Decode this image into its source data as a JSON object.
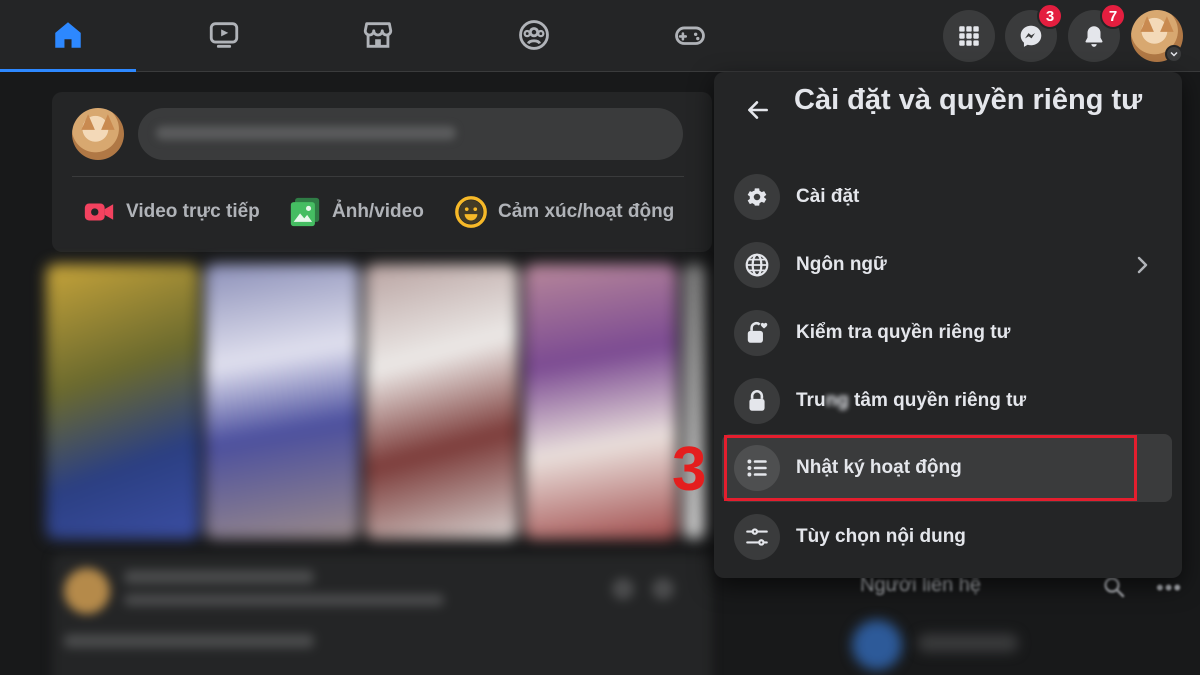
{
  "nav": {
    "tabs": [
      {
        "icon": "home-icon",
        "active": true
      },
      {
        "icon": "watch-video-icon",
        "active": false
      },
      {
        "icon": "marketplace-icon",
        "active": false
      },
      {
        "icon": "groups-icon",
        "active": false
      },
      {
        "icon": "gaming-icon",
        "active": false
      }
    ],
    "messenger_badge": "3",
    "notifications_badge": "7"
  },
  "composer": {
    "actions": [
      {
        "label": "Video trực tiếp",
        "icon": "live-video-icon",
        "color": "#f3425f"
      },
      {
        "label": "Ảnh/video",
        "icon": "photo-video-icon",
        "color": "#45bd62"
      },
      {
        "label": "Cảm xúc/hoạt động",
        "icon": "feeling-icon",
        "color": "#f7b928"
      }
    ]
  },
  "contacts": {
    "title": "Người liên hệ"
  },
  "menu": {
    "title": "Cài đặt và quyền riêng tư",
    "items": [
      {
        "label": "Cài đặt",
        "icon": "gear-icon"
      },
      {
        "label": "Ngôn ngữ",
        "icon": "globe-icon",
        "has_submenu": true
      },
      {
        "label": "Kiểm tra quyền riêng tư",
        "icon": "lock-heart-icon"
      },
      {
        "label_prefix": "Tru",
        "label_blurred": "ng",
        "label_suffix": " tâm quyền riêng tư",
        "icon": "lock-icon"
      },
      {
        "label": "Nhật ký hoạt động",
        "icon": "list-icon",
        "highlighted": true
      },
      {
        "label": "Tùy chọn nội dung",
        "icon": "sliders-icon"
      }
    ]
  },
  "annotation": {
    "step": "3",
    "color": "#e41e2e"
  },
  "colors": {
    "accent": "#2d88ff",
    "background": "#18191a",
    "surface": "#242526",
    "badge": "#e41e3f"
  }
}
